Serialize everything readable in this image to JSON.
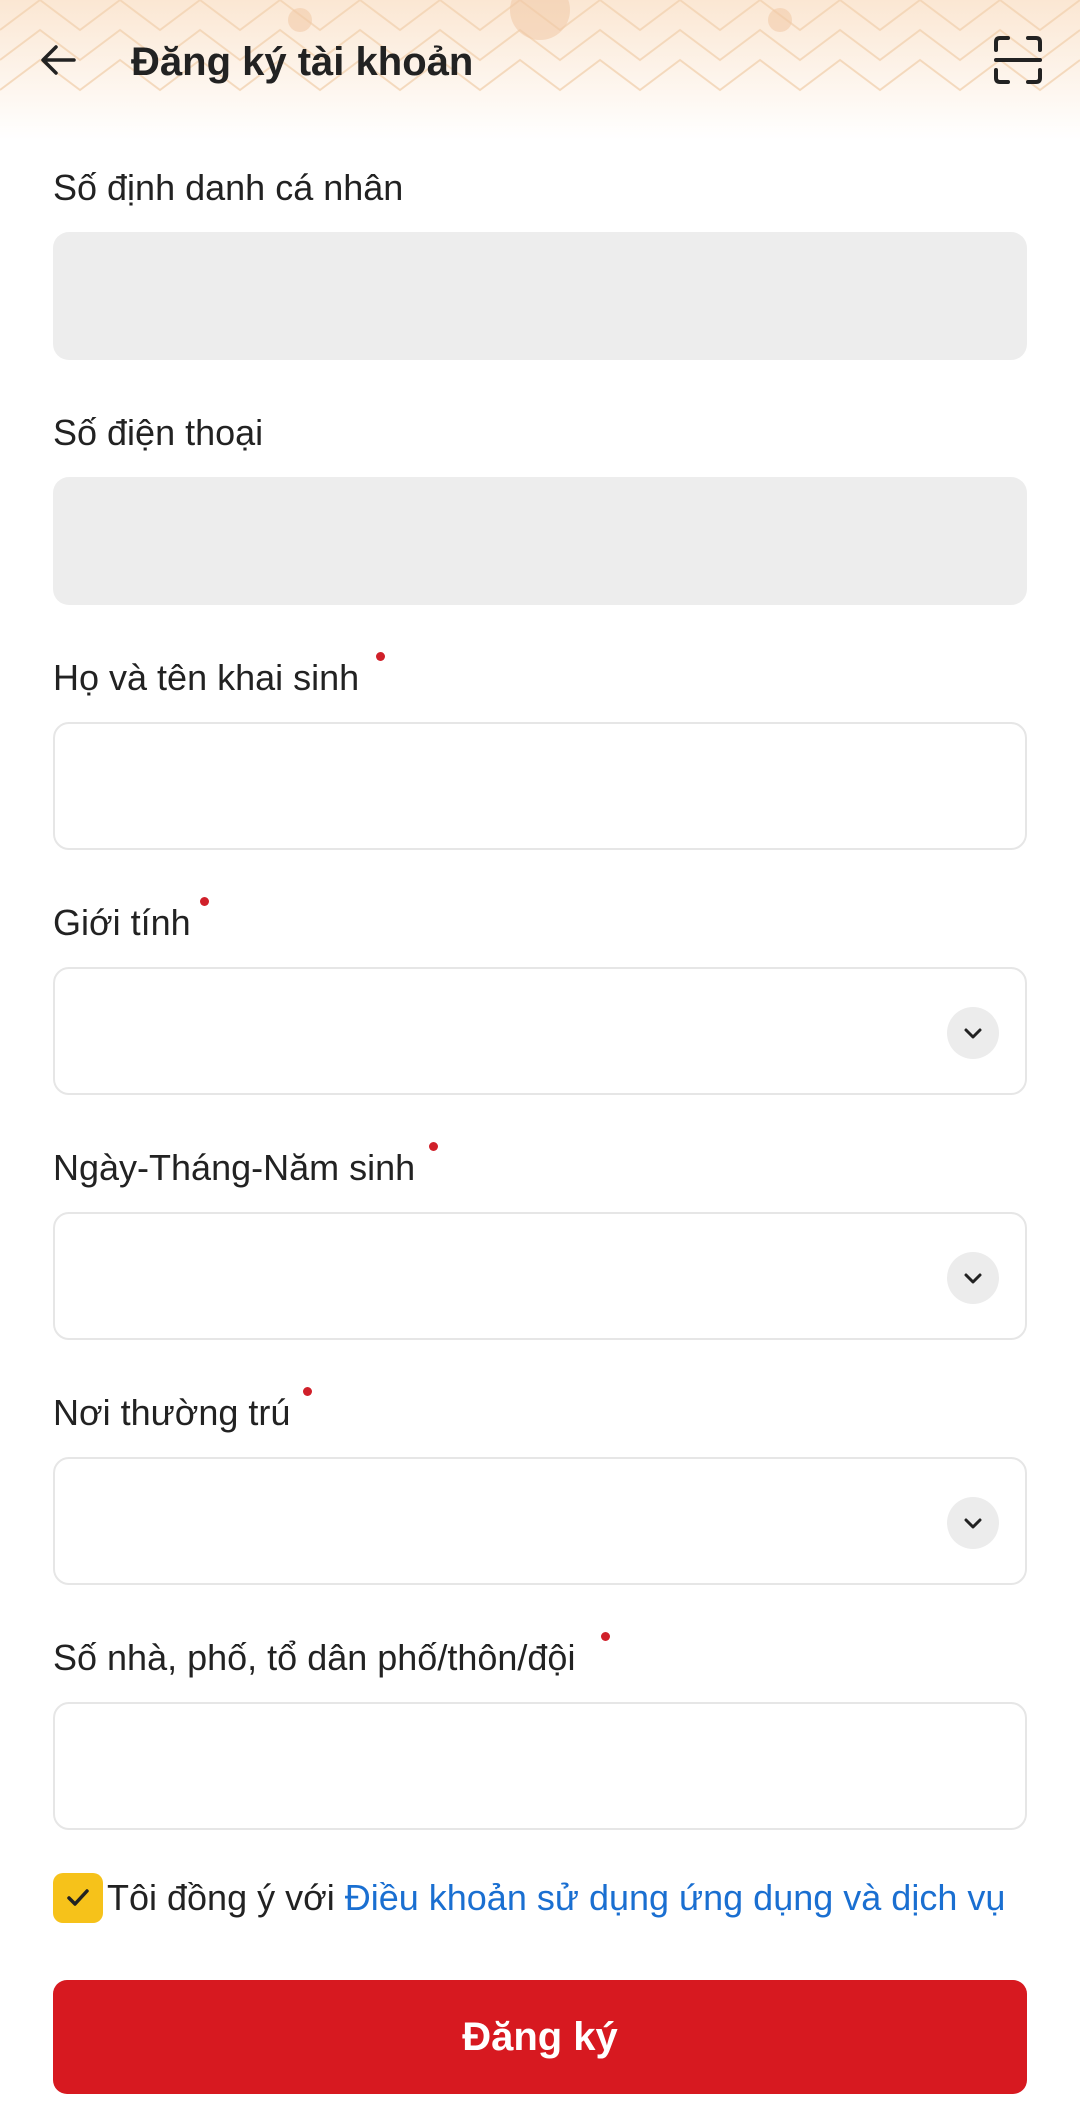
{
  "header": {
    "title": "Đăng ký tài khoản",
    "back_icon": "arrow-left-icon",
    "scan_icon": "scan-frame-icon"
  },
  "fields": [
    {
      "label": "Số định danh cá nhân",
      "required": false,
      "type": "disabled",
      "value": ""
    },
    {
      "label": "Số điện thoại",
      "required": false,
      "type": "disabled",
      "value": ""
    },
    {
      "label": "Họ và tên khai sinh",
      "required": true,
      "type": "text",
      "value": ""
    },
    {
      "label": "Giới tính",
      "required": true,
      "type": "select",
      "value": ""
    },
    {
      "label": "Ngày-Tháng-Năm sinh",
      "required": true,
      "type": "select",
      "value": ""
    },
    {
      "label": "Nơi thường trú",
      "required": true,
      "type": "select",
      "value": ""
    },
    {
      "label": "Số nhà, phố, tổ dân phố/thôn/đội",
      "required": true,
      "type": "text",
      "value": ""
    }
  ],
  "agreement": {
    "checked": true,
    "text": "Tôi đồng ý với",
    "link": "Điều khoản sử dụng ứng dụng và dịch vụ"
  },
  "submit_label": "Đăng ký",
  "colors": {
    "primary": "#d71920",
    "link": "#1a6fd1",
    "checkbox": "#f6c21a",
    "required_dot": "#d0202a",
    "disabled_bg": "#ededed"
  }
}
